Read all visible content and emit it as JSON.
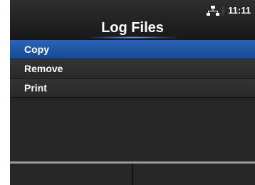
{
  "header": {
    "title": "Log Files",
    "time": "11:11",
    "icons": [
      "network-icon",
      "link-icon"
    ]
  },
  "menu": {
    "items": [
      {
        "label": "Copy",
        "selected": true
      },
      {
        "label": "Remove",
        "selected": false
      },
      {
        "label": "Print",
        "selected": false
      }
    ]
  },
  "footer": {
    "softkeys": [
      "",
      ""
    ]
  },
  "colors": {
    "background": "#262626",
    "selection": "#1f56a6",
    "text": "#ffffff",
    "footer_border": "#9a9a9a"
  }
}
